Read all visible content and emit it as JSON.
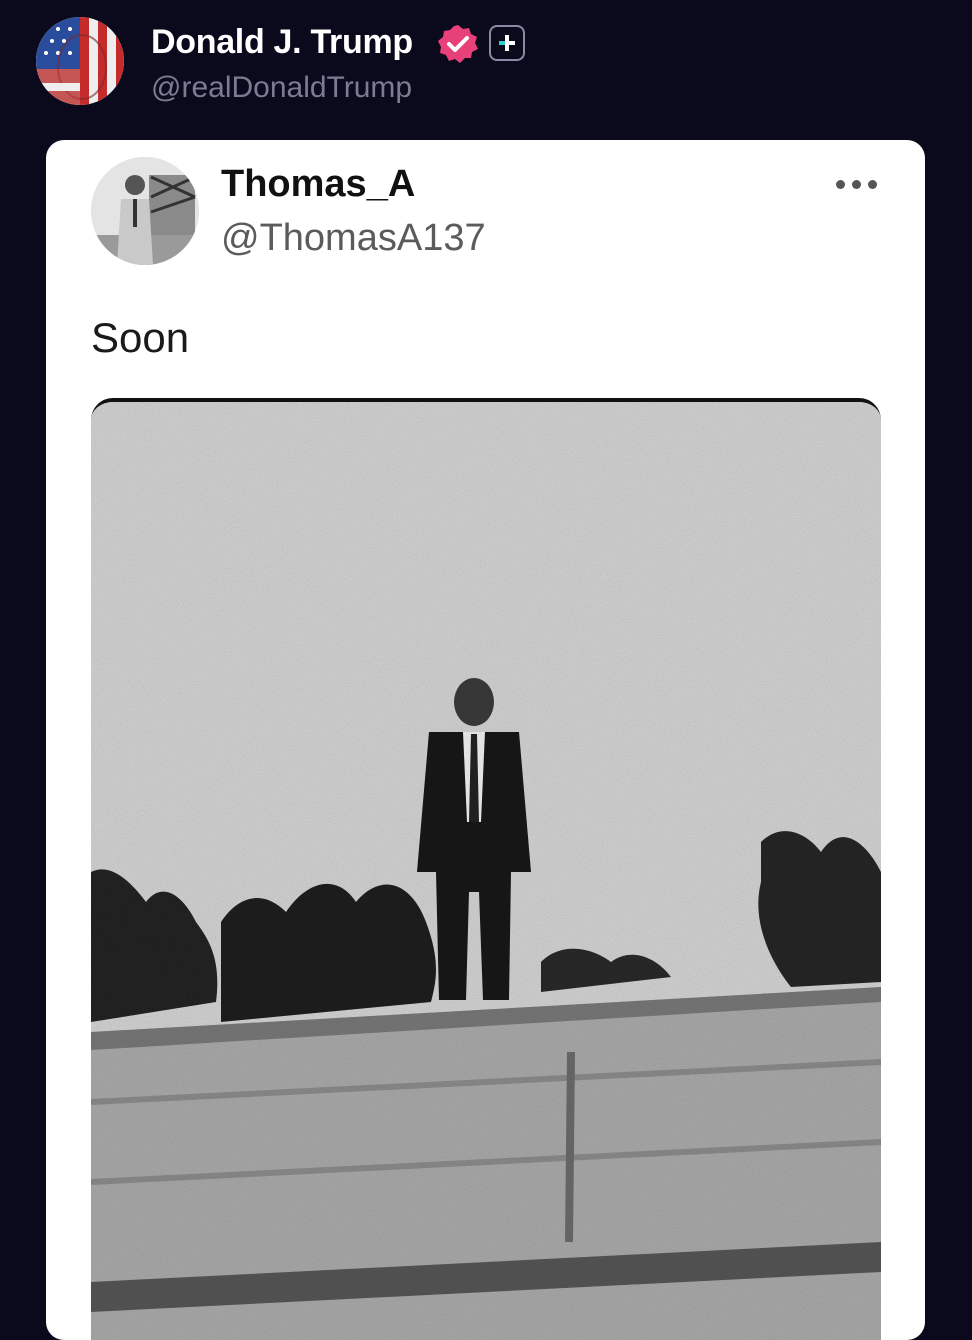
{
  "poster": {
    "name": "Donald J. Trump",
    "handle": "@realDonaldTrump",
    "verified_color": "#e8417a",
    "avatar_icon": "flag-face-avatar"
  },
  "quoted_post": {
    "name": "Thomas_A",
    "handle": "@ThomasA137",
    "text": "Soon",
    "more_icon": "ellipsis-icon",
    "image_desc_icon": "figure-on-rooftop-photo"
  },
  "colors": {
    "background": "#0b0a1c",
    "card": "#ffffff",
    "handle": "#7b7b93"
  }
}
